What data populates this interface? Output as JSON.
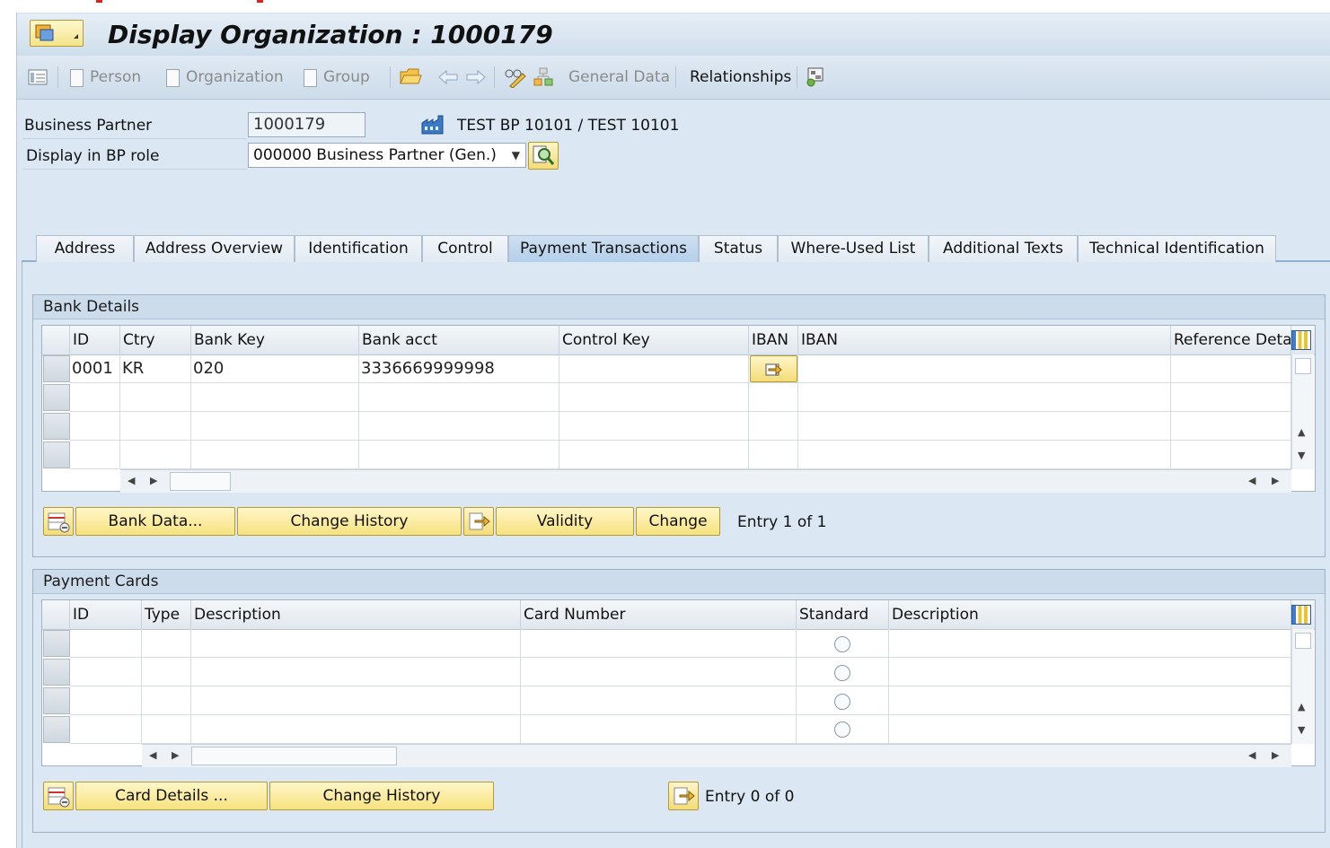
{
  "window": {
    "title": "Display Organization : 1000179"
  },
  "toolbar": {
    "person": "Person",
    "organization": "Organization",
    "group": "Group",
    "general_data": "General Data",
    "relationships": "Relationships"
  },
  "header": {
    "bp_label": "Business Partner",
    "bp_value": "1000179",
    "bp_name": "TEST BP 10101 / TEST 10101",
    "role_label": "Display in BP role",
    "role_value": "000000 Business Partner (Gen.)"
  },
  "tabs": [
    {
      "label": "Address"
    },
    {
      "label": "Address Overview"
    },
    {
      "label": "Identification"
    },
    {
      "label": "Control"
    },
    {
      "label": "Payment Transactions",
      "active": true
    },
    {
      "label": "Status"
    },
    {
      "label": "Where-Used List"
    },
    {
      "label": "Additional Texts"
    },
    {
      "label": "Technical Identification"
    }
  ],
  "bank_details": {
    "title": "Bank Details",
    "columns": [
      "ID",
      "Ctry",
      "Bank Key",
      "Bank acct",
      "Control Key",
      "IBAN",
      "IBAN",
      "Reference Details"
    ],
    "rows": [
      {
        "id": "0001",
        "ctry": "KR",
        "bank_key": "020",
        "bank_acct": "3336669999998",
        "control_key": "",
        "iban": "",
        "reference": ""
      }
    ],
    "buttons": {
      "bank_data": "Bank Data...",
      "change_history": "Change History",
      "validity": "Validity",
      "change": "Change"
    },
    "entry": "Entry 1 of 1"
  },
  "payment_cards": {
    "title": "Payment Cards",
    "columns": [
      "ID",
      "Type",
      "Description",
      "Card Number",
      "Standard",
      "Description"
    ],
    "buttons": {
      "card_details": "Card Details ...",
      "change_history": "Change History"
    },
    "entry": "Entry 0 of 0"
  },
  "colors": {
    "accent": "#f7e27f",
    "panel": "#dbe8f3",
    "active_tab": "#b3cfe9"
  }
}
